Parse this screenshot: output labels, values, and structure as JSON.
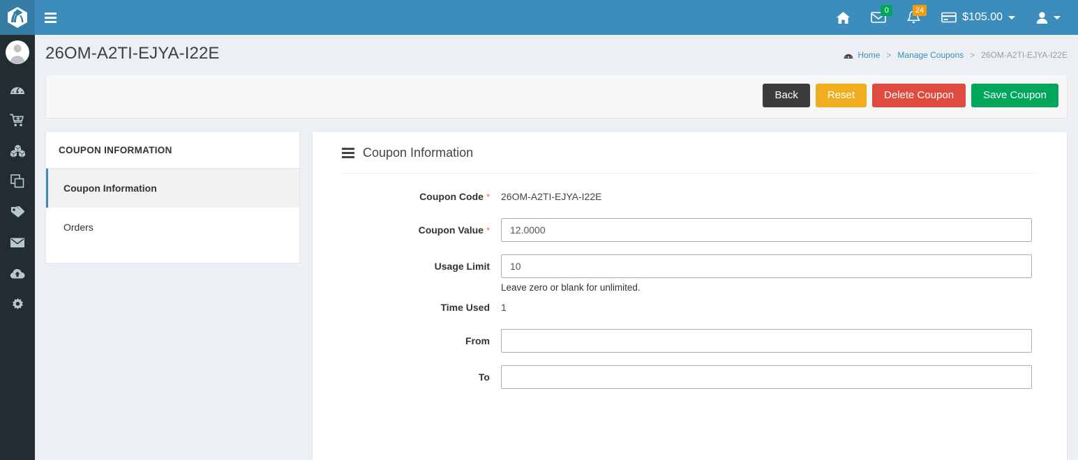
{
  "header": {
    "logo_icon": "leaf-stack-logo",
    "menu_toggle_icon": "hamburger-icon",
    "home_icon": "home-icon",
    "messages_icon": "envelope-icon",
    "messages_badge": "0",
    "notifications_icon": "bell-icon",
    "notifications_badge": "24",
    "wallet_icon": "credit-card-icon",
    "wallet_amount": "$105.00",
    "user_icon": "user-icon"
  },
  "sidebar": {
    "avatar": "user-avatar",
    "items": [
      {
        "icon": "dashboard-icon",
        "name": "sidebar-item-dashboard"
      },
      {
        "icon": "cart-icon",
        "name": "sidebar-item-orders"
      },
      {
        "icon": "cubes-icon",
        "name": "sidebar-item-products"
      },
      {
        "icon": "clone-icon",
        "name": "sidebar-item-pages"
      },
      {
        "icon": "tags-icon",
        "name": "sidebar-item-coupons"
      },
      {
        "icon": "envelope-icon",
        "name": "sidebar-item-mail"
      },
      {
        "icon": "cloud-upload-icon",
        "name": "sidebar-item-import"
      },
      {
        "icon": "gear-icon",
        "name": "sidebar-item-settings"
      }
    ]
  },
  "content_header": {
    "title": "26OM-A2TI-EJYA-I22E",
    "breadcrumb": {
      "icon": "dashboard-icon",
      "home": "Home",
      "sep1": ">",
      "parent": "Manage Coupons",
      "sep2": ">",
      "current": "26OM-A2TI-EJYA-I22E"
    }
  },
  "toolbar": {
    "back_label": "Back",
    "reset_label": "Reset",
    "delete_label": "Delete Coupon",
    "save_label": "Save Coupon"
  },
  "left_panel": {
    "header": "COUPON INFORMATION",
    "items": [
      {
        "label": "Coupon Information",
        "active": true
      },
      {
        "label": "Orders",
        "active": false
      }
    ]
  },
  "main_panel": {
    "section_icon": "bars-icon",
    "section_title": "Coupon Information",
    "fields": {
      "coupon_code": {
        "label": "Coupon Code",
        "required": "*",
        "value": "26OM-A2TI-EJYA-I22E"
      },
      "coupon_value": {
        "label": "Coupon Value",
        "required": "*",
        "value": "12.0000",
        "placeholder": ""
      },
      "usage_limit": {
        "label": "Usage Limit",
        "value": "10",
        "placeholder": "",
        "help": "Leave zero or blank for unlimited."
      },
      "time_used": {
        "label": "Time Used",
        "value": "1"
      },
      "from": {
        "label": "From",
        "value": "",
        "placeholder": ""
      },
      "to": {
        "label": "To",
        "value": "",
        "placeholder": ""
      }
    }
  },
  "colors": {
    "header_blue": "#3c8dbc",
    "sidebar_dark": "#222d32",
    "page_bg": "#ecf0f5",
    "btn_back": "#3c3c3c",
    "btn_reset": "#f0ad1e",
    "btn_delete": "#e04b3f",
    "btn_save": "#00a65a",
    "badge_green": "#00a65a",
    "badge_orange": "#f39c12",
    "required_asterisk": "#ef6c3c",
    "active_accent": "#3c8dbc"
  }
}
